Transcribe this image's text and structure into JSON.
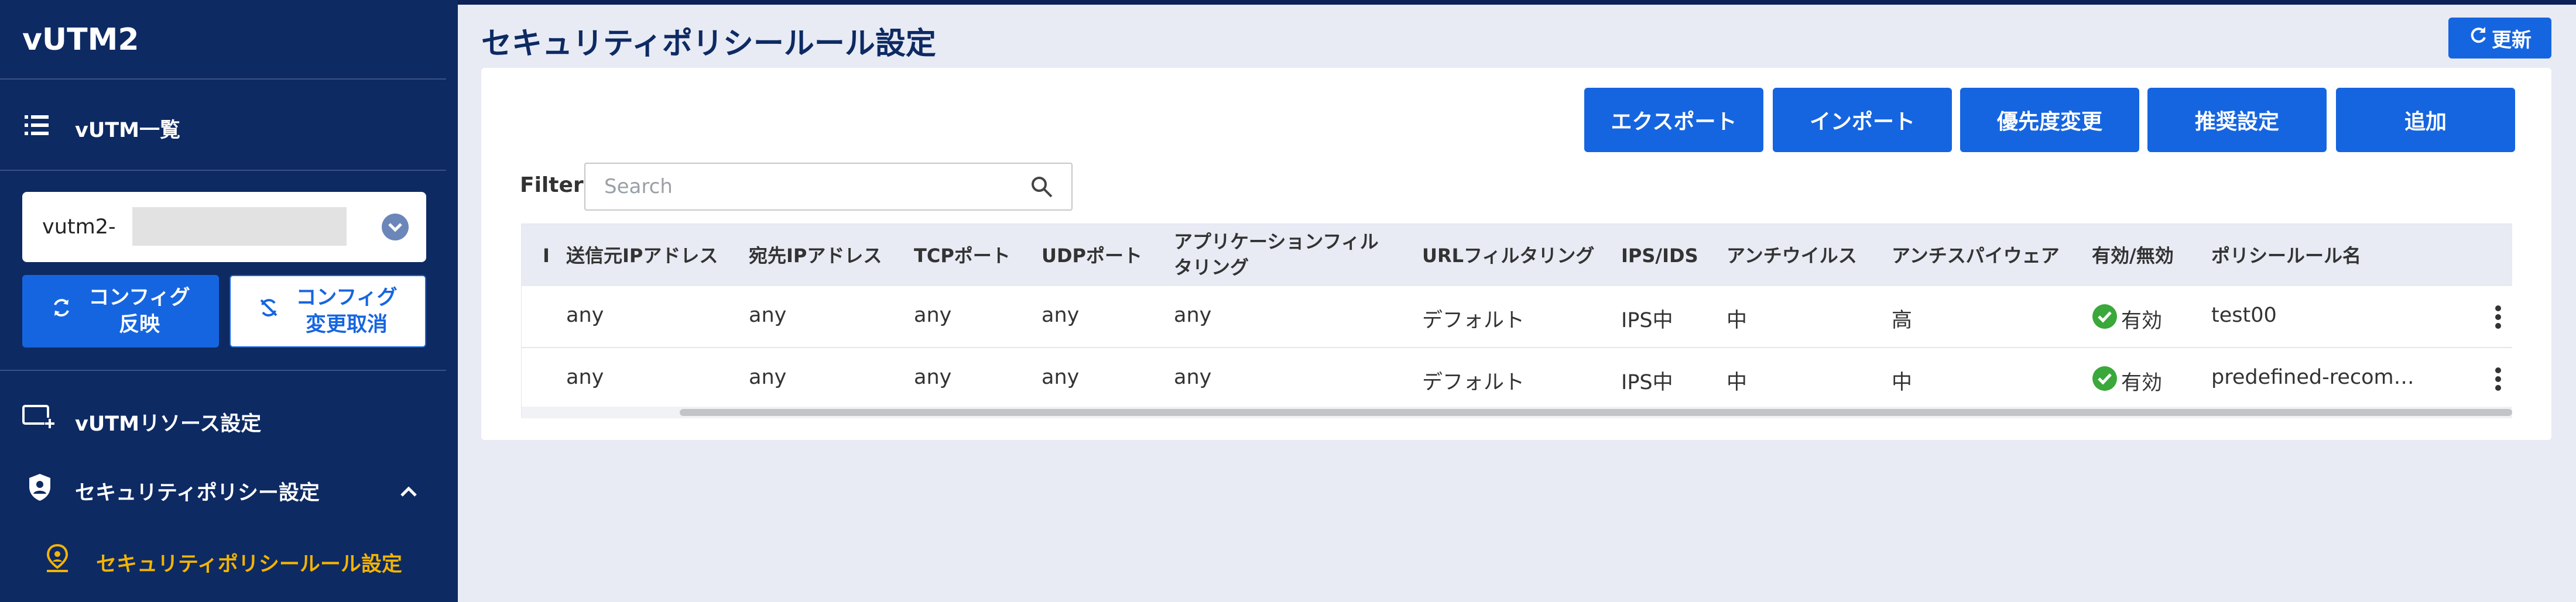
{
  "sidebar": {
    "brand": "vUTM2",
    "nav_vutm_list": "vUTM一覧",
    "selected_vutm": "vutm2-",
    "btn_apply_config": "コンフィグ\n反映",
    "btn_cancel_config": "コンフィグ\n変更取消",
    "nav_resource": "vUTMリソース設定",
    "nav_security_policy": "セキュリティポリシー設定",
    "nav_security_policy_rule": "セキュリティポリシールール設定"
  },
  "header": {
    "title": "セキュリティポリシールール設定",
    "refresh_label": "更新"
  },
  "actions": [
    "エクスポート",
    "インポート",
    "優先度変更",
    "推奨設定",
    "追加"
  ],
  "filter": {
    "label": "Filter",
    "placeholder": "Search",
    "value": ""
  },
  "table": {
    "columns": [
      "I",
      "送信元IPアドレス",
      "宛先IPアドレス",
      "TCPポート",
      "UDPポート",
      "アプリケーションフィルタリング",
      "URLフィルタリング",
      "IPS/IDS",
      "アンチウイルス",
      "アンチスパイウェア",
      "有効/無効",
      "ポリシールール名"
    ],
    "col_app_line1": "アプリケーションフィル",
    "col_app_line2": "タリング",
    "rows": [
      {
        "src": "any",
        "dst": "any",
        "tcp": "any",
        "udp": "any",
        "app": "any",
        "url": "デフォルト",
        "ips": "IPS中",
        "av": "中",
        "as": "高",
        "status": "有効",
        "name": "test00"
      },
      {
        "src": "any",
        "dst": "any",
        "tcp": "any",
        "udp": "any",
        "app": "any",
        "url": "デフォルト",
        "ips": "IPS中",
        "av": "中",
        "as": "中",
        "status": "有効",
        "name": "predefined-recom…"
      }
    ]
  },
  "colors": {
    "sidebar_bg": "#0d2a63",
    "primary": "#1665e0",
    "active_nav": "#f5b400",
    "status_ok": "#3aa83a"
  }
}
